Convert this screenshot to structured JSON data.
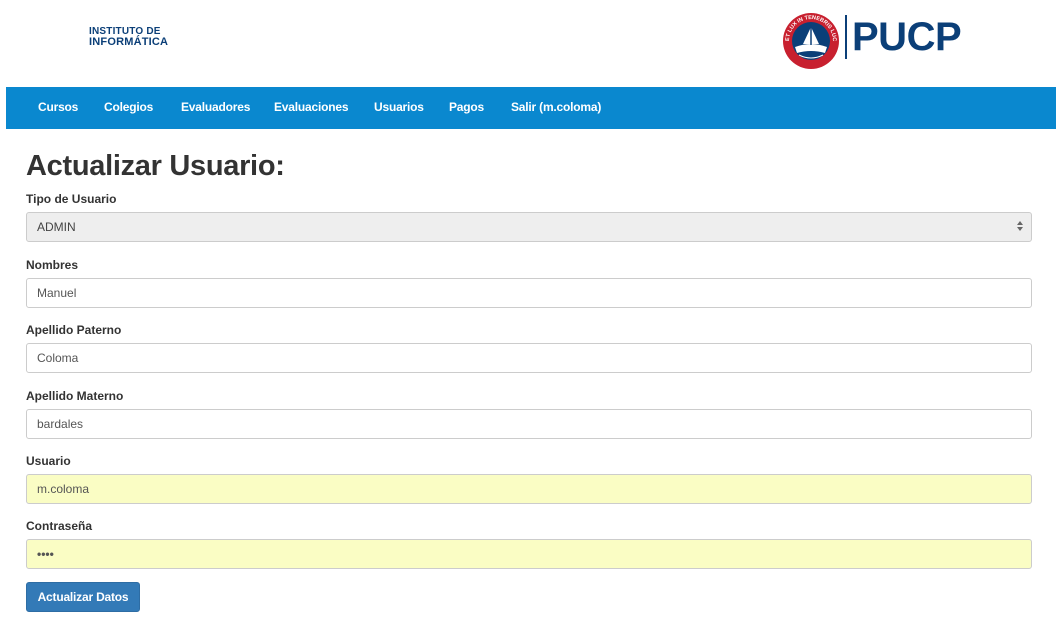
{
  "header": {
    "institute_line1": "INSTITUTO DE",
    "institute_line2": "INFORMÁTICA",
    "brand": "PUCP",
    "seal_text": "ET LUX IN TENEBRIS LUCET",
    "seal_year": "MCMXVII"
  },
  "nav": {
    "items": [
      {
        "label": "Cursos"
      },
      {
        "label": "Colegios"
      },
      {
        "label": "Evaluadores"
      },
      {
        "label": "Evaluaciones"
      },
      {
        "label": "Usuarios"
      },
      {
        "label": "Pagos"
      },
      {
        "label": "Salir (m.coloma)"
      }
    ]
  },
  "main": {
    "title": "Actualizar Usuario:",
    "fields": {
      "tipo": {
        "label": "Tipo de Usuario",
        "value": "ADMIN"
      },
      "nombres": {
        "label": "Nombres",
        "value": "Manuel"
      },
      "paterno": {
        "label": "Apellido Paterno",
        "value": "Coloma"
      },
      "materno": {
        "label": "Apellido Materno",
        "value": "bardales"
      },
      "usuario": {
        "label": "Usuario",
        "value": "m.coloma"
      },
      "password": {
        "label": "Contraseña",
        "value": "••••"
      }
    },
    "submit_label": "Actualizar Datos"
  },
  "colors": {
    "navbar": "#0a88cf",
    "brand_blue": "#0b3f78",
    "button": "#337ab7",
    "autofill": "#fafdc4"
  }
}
